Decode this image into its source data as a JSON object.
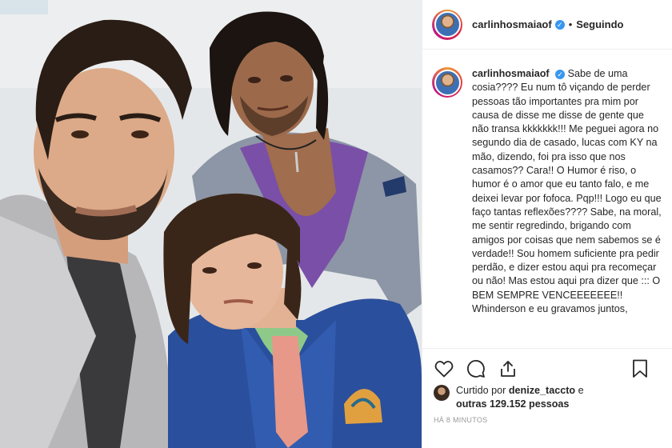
{
  "post": {
    "photo_alt": "",
    "header": {
      "username": "carlinhosmaiaof",
      "verified_icon": "verified-badge-icon",
      "separator": "•",
      "follow_status": "Seguindo"
    },
    "caption": {
      "username": "carlinhosmaiaof",
      "text": "Sabe de uma cosia???? Eu num tô viçando de perder pessoas tão importantes pra mim por causa de disse me disse de gente que não transa kkkkkkk!!! Me peguei agora no segundo dia de casado, lucas com KY na mão, dizendo, foi pra isso que nos casamos?? Cara!! O Humor é riso, o humor é o amor que eu tanto falo, e me deixei levar por fofoca. Pqp!!! Logo eu que faço tantas reflexões???? Sabe, na moral, me sentir regredindo, brigando com amigos por coisas que nem sabemos se é verdade!! Sou homem suficiente pra pedir perdão, e dizer estou aqui pra recomeçar ou não! Mas estou aqui pra dizer que ::: O BEM SEMPRE VENCEEEEEEE!! Whinderson e eu gravamos juntos,"
    },
    "actions": {
      "like_icon": "heart-icon",
      "comment_icon": "comment-icon",
      "share_icon": "share-icon",
      "save_icon": "bookmark-icon"
    },
    "likes": {
      "prefix": "Curtido por ",
      "user": "denize_taccto",
      "middle": " e",
      "others": "outras 129.152 pessoas"
    },
    "timestamp": "HÁ 8 MINUTOS"
  },
  "colors": {
    "accent_verified": "#3897f0",
    "text": "#262626",
    "muted": "#999999",
    "divider": "#efefef"
  }
}
